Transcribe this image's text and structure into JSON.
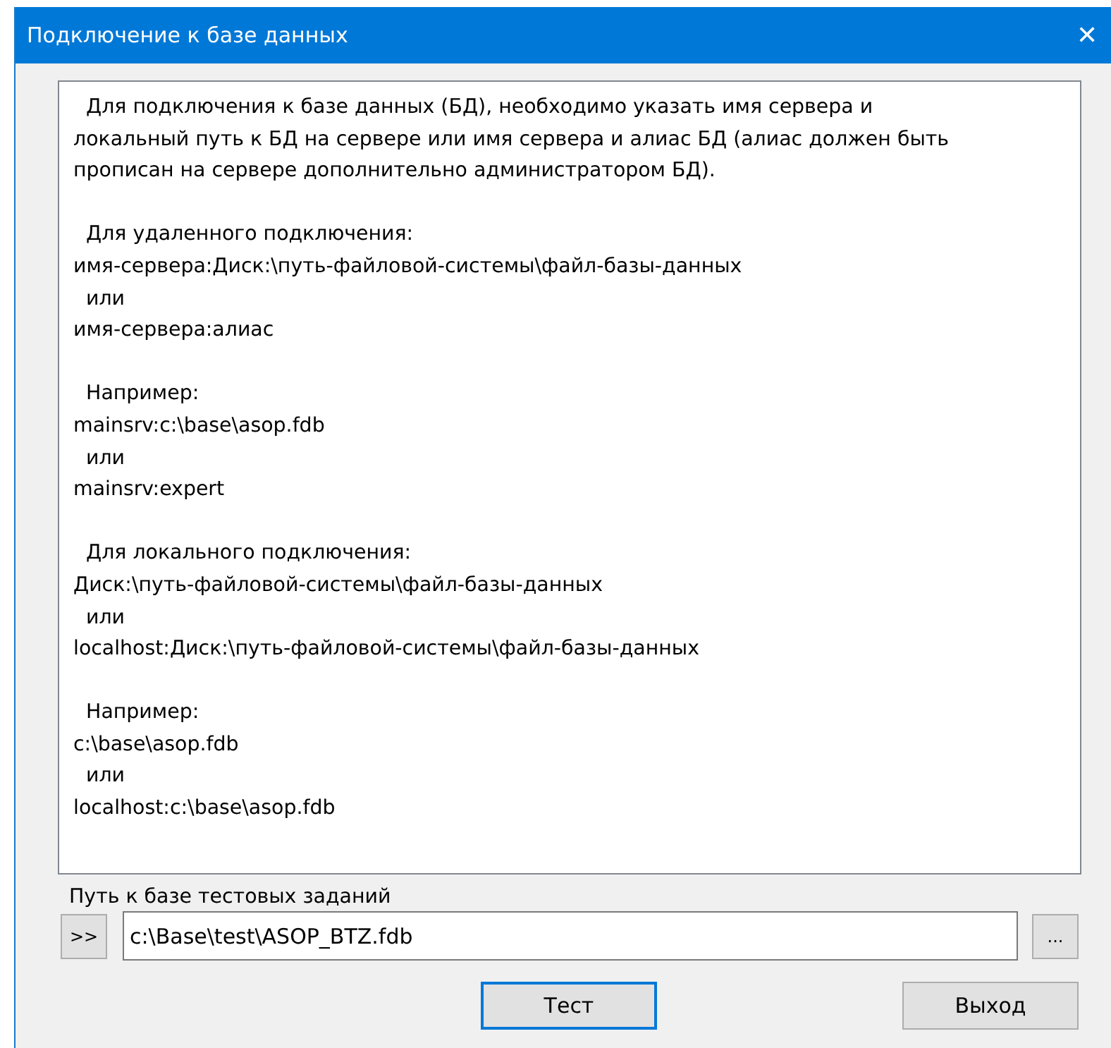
{
  "window": {
    "title": "Подключение к базе данных",
    "close": "✕"
  },
  "memo": [
    [
      "  Для подключения к базе данных (БД), необходимо указать имя сервера и",
      "локальный путь к БД на сервере или имя сервера и алиас БД (алиас должен быть",
      "прописан на сервере дополнительно администратором БД)."
    ],
    [
      "  Для удаленного подключения:",
      "имя-сервера:Диск:\\путь-файловой-системы\\файл-базы-данных",
      "  или",
      "имя-сервера:алиас"
    ],
    [
      "  Например:",
      "mainsrv:c:\\base\\asop.fdb",
      "  или",
      "mainsrv:expert"
    ],
    [
      "  Для локального подключения:",
      "Диск:\\путь-файловой-системы\\файл-базы-данных",
      "  или",
      "localhost:Диск:\\путь-файловой-системы\\файл-базы-данных"
    ],
    [
      "  Например:",
      "c:\\base\\asop.fdb",
      "  или",
      "localhost:c:\\base\\asop.fdb"
    ]
  ],
  "path": {
    "label": "Путь к базе тестовых заданий",
    "insert_button": ">>",
    "value": "c:\\Base\\test\\ASOP_BTZ.fdb",
    "browse_button": "..."
  },
  "buttons": [
    {
      "label": "Тест",
      "focused": true
    },
    {
      "label": "Выход",
      "focused": false
    }
  ]
}
